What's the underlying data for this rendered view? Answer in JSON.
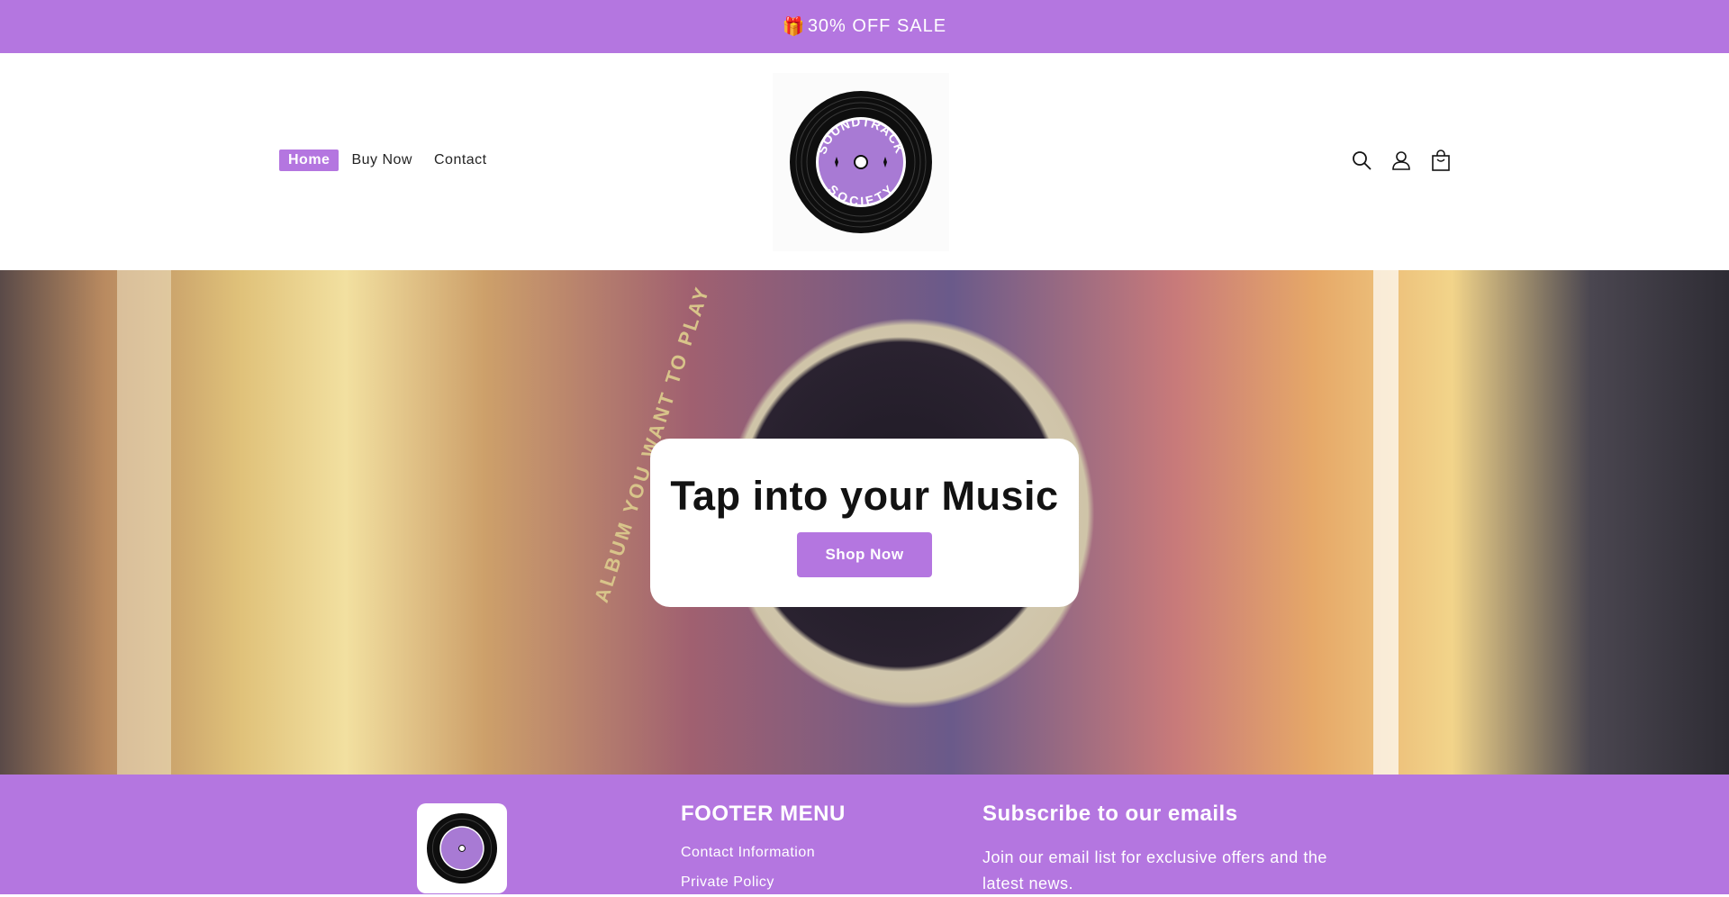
{
  "announcement": {
    "gift_emoji": "🎁",
    "text": "30% OFF SALE"
  },
  "nav": {
    "items": [
      {
        "label": "Home",
        "active": true
      },
      {
        "label": "Buy Now",
        "active": false
      },
      {
        "label": "Contact",
        "active": false
      }
    ]
  },
  "logo": {
    "top_text": "SOUNDTRACK",
    "bottom_text": "SOCIETY"
  },
  "header_icons": [
    "search-icon",
    "account-icon",
    "cart-icon"
  ],
  "hero": {
    "ring_text": "ALBUM YOU WANT TO PLAY",
    "heading": "Tap into your Music",
    "button_label": "Shop Now"
  },
  "footer": {
    "menu_title": "FOOTER MENU",
    "menu_items": [
      "Contact Information",
      "Private Policy"
    ],
    "subscribe_title": "Subscribe to our emails",
    "subscribe_text": "Join our email list for exclusive offers and the latest news."
  },
  "colors": {
    "accent": "#b476e0",
    "text": "#121212",
    "white": "#ffffff"
  }
}
